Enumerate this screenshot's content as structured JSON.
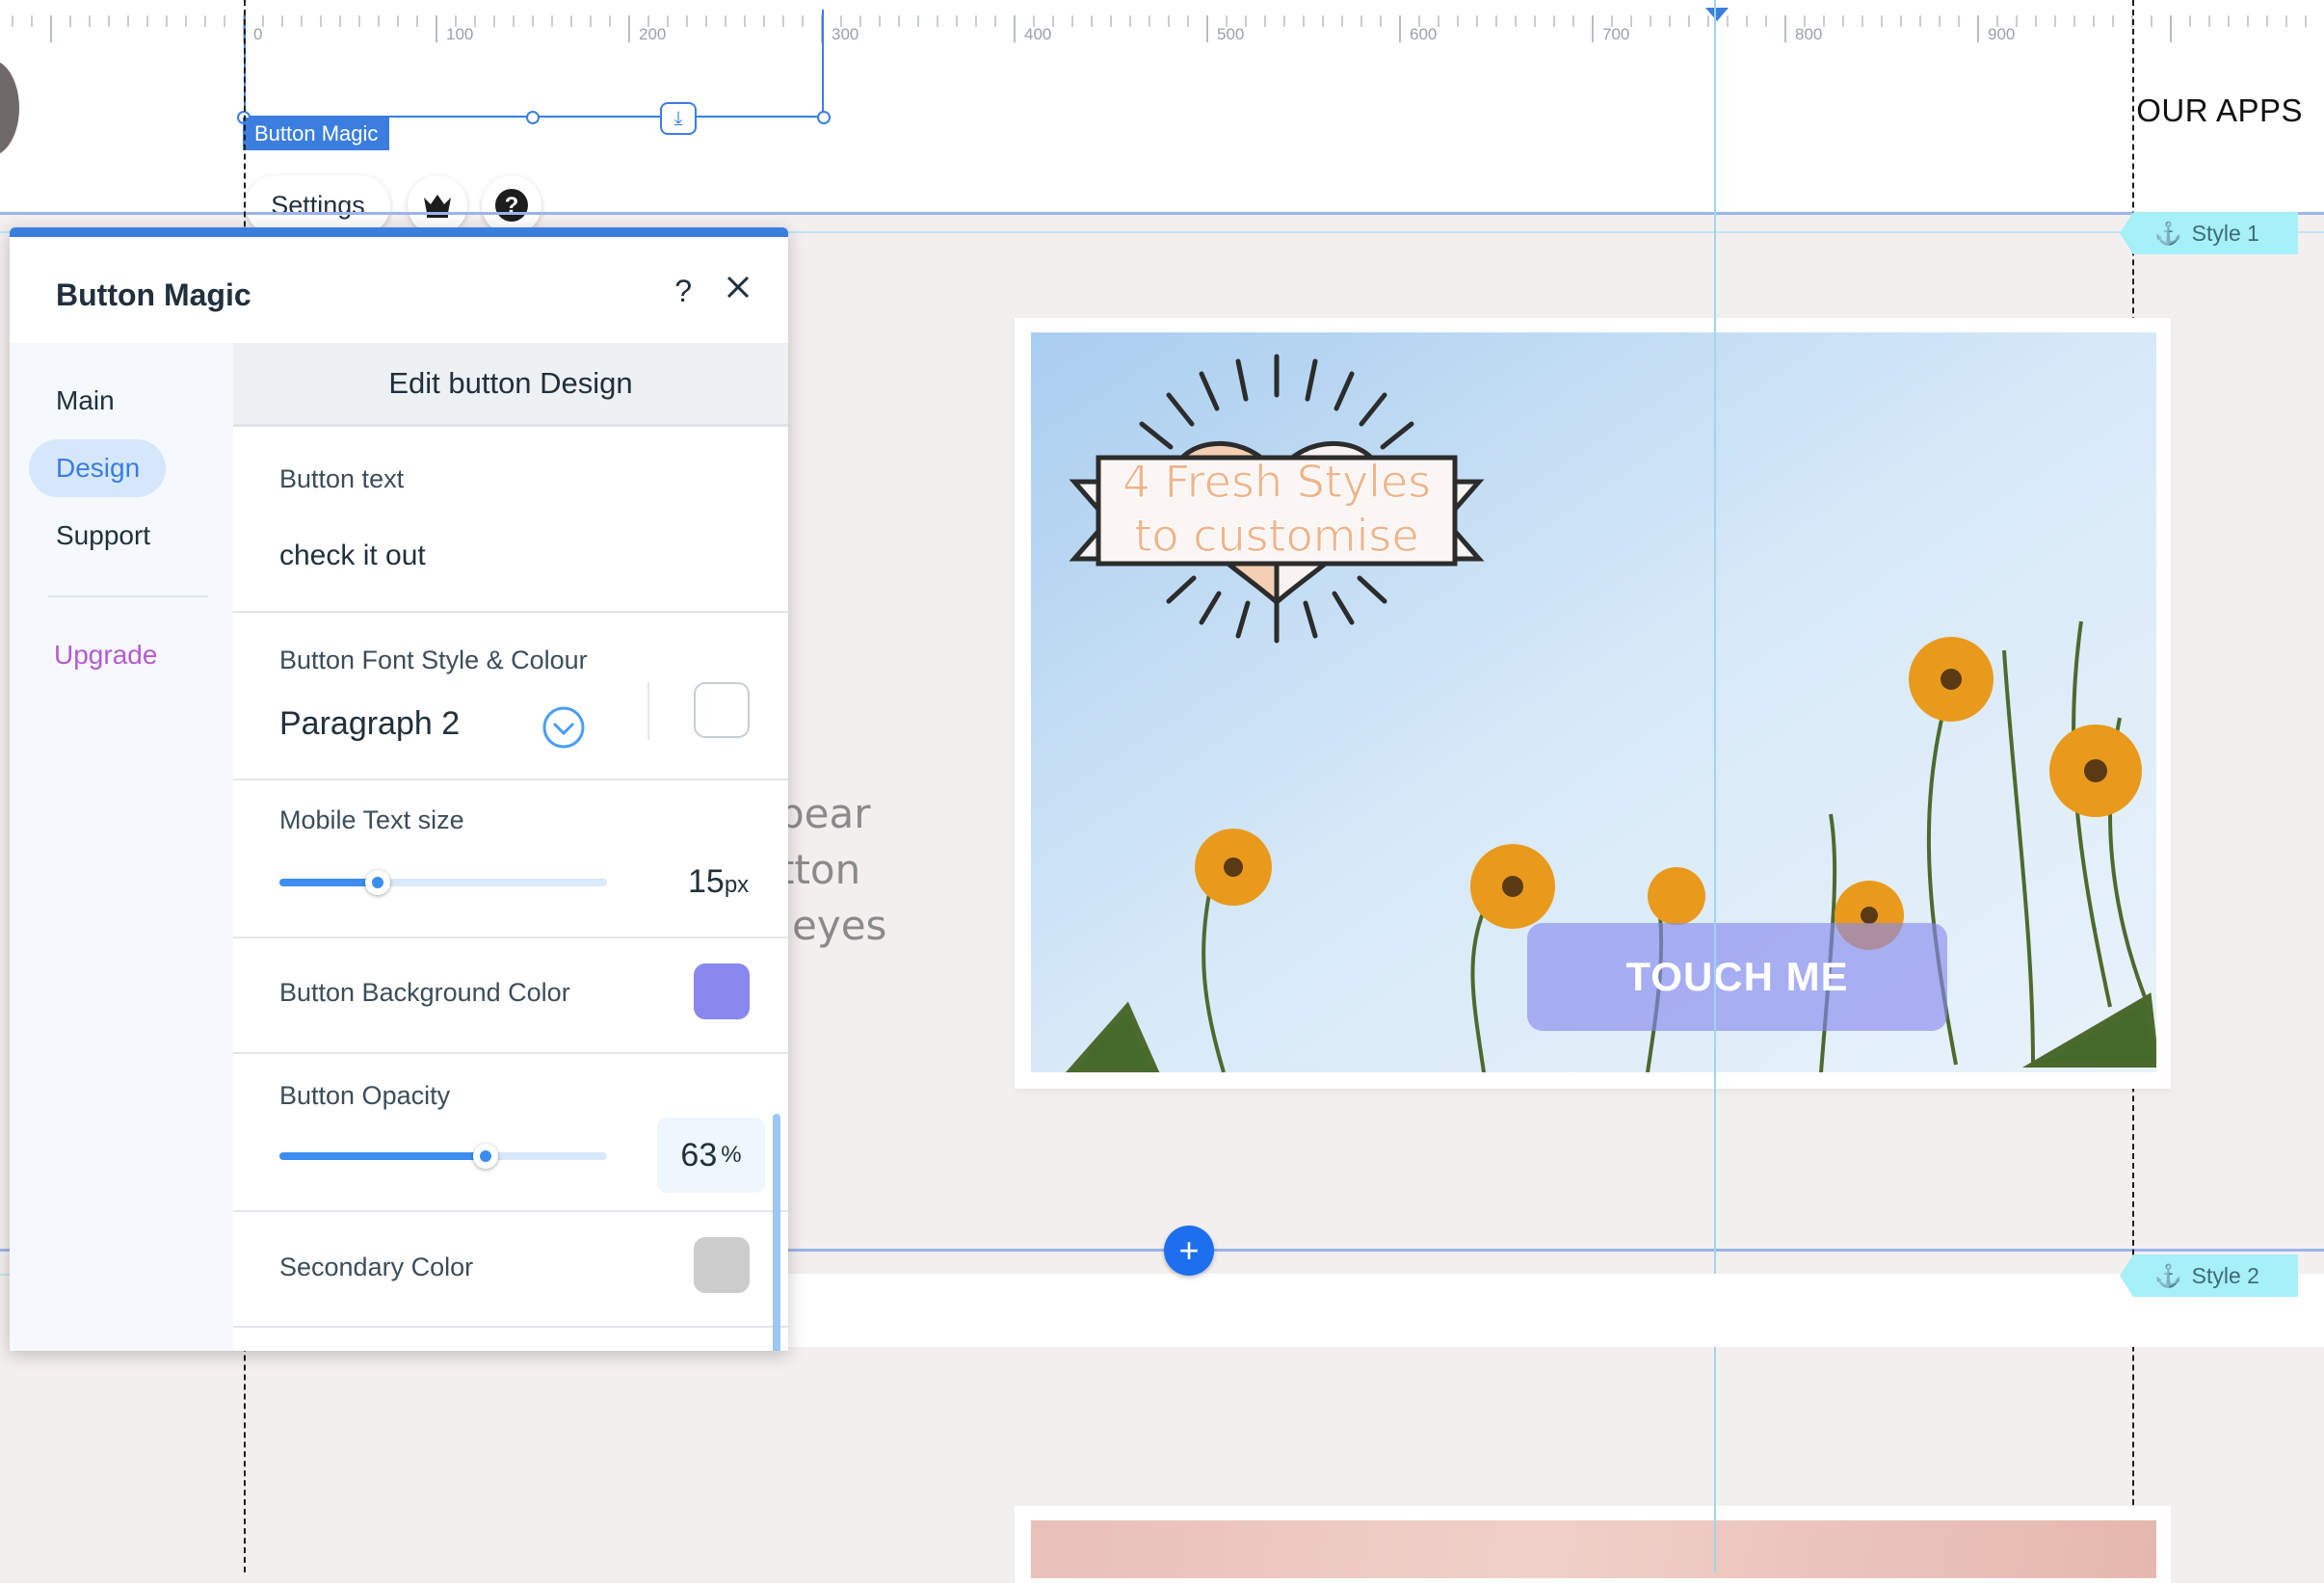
{
  "ruler": {
    "marks": [
      "0",
      "100",
      "200",
      "300",
      "400",
      "500",
      "600",
      "700",
      "800",
      "900"
    ]
  },
  "header": {
    "our_apps": "OUR APPS"
  },
  "selection": {
    "tag": "Button Magic",
    "settings_label": "Settings"
  },
  "sections": {
    "style1": "Style 1",
    "style2": "Style 2"
  },
  "canvas": {
    "touch_button": "TOUCH ME",
    "badge_line1": "4 Fresh Styles",
    "badge_line2": "to customise",
    "bg_text": [
      "pear",
      "tton",
      "eyes"
    ]
  },
  "panel": {
    "title": "Button Magic",
    "help": "?",
    "nav": [
      "Main",
      "Design",
      "Support",
      "Upgrade"
    ],
    "content_title": "Edit button Design",
    "button_text_label": "Button text",
    "button_text_value": "check it out",
    "font_style_label": "Button Font Style & Colour",
    "font_style_value": "Paragraph 2",
    "mobile_text_label": "Mobile Text size",
    "mobile_text_value": "15",
    "mobile_text_unit": "px",
    "mobile_text_fraction": 0.3,
    "bg_color_label": "Button Background Color",
    "bg_color": "#8a88ee",
    "opacity_label": "Button Opacity",
    "opacity_value": "63",
    "opacity_unit": "%",
    "opacity_fraction": 0.63,
    "secondary_label": "Secondary Color",
    "secondary_color": "#cccccc",
    "font_color": "#ffffff"
  },
  "colors": {
    "accent": "#3b7ee0",
    "upgrade": "#b65ad1"
  }
}
